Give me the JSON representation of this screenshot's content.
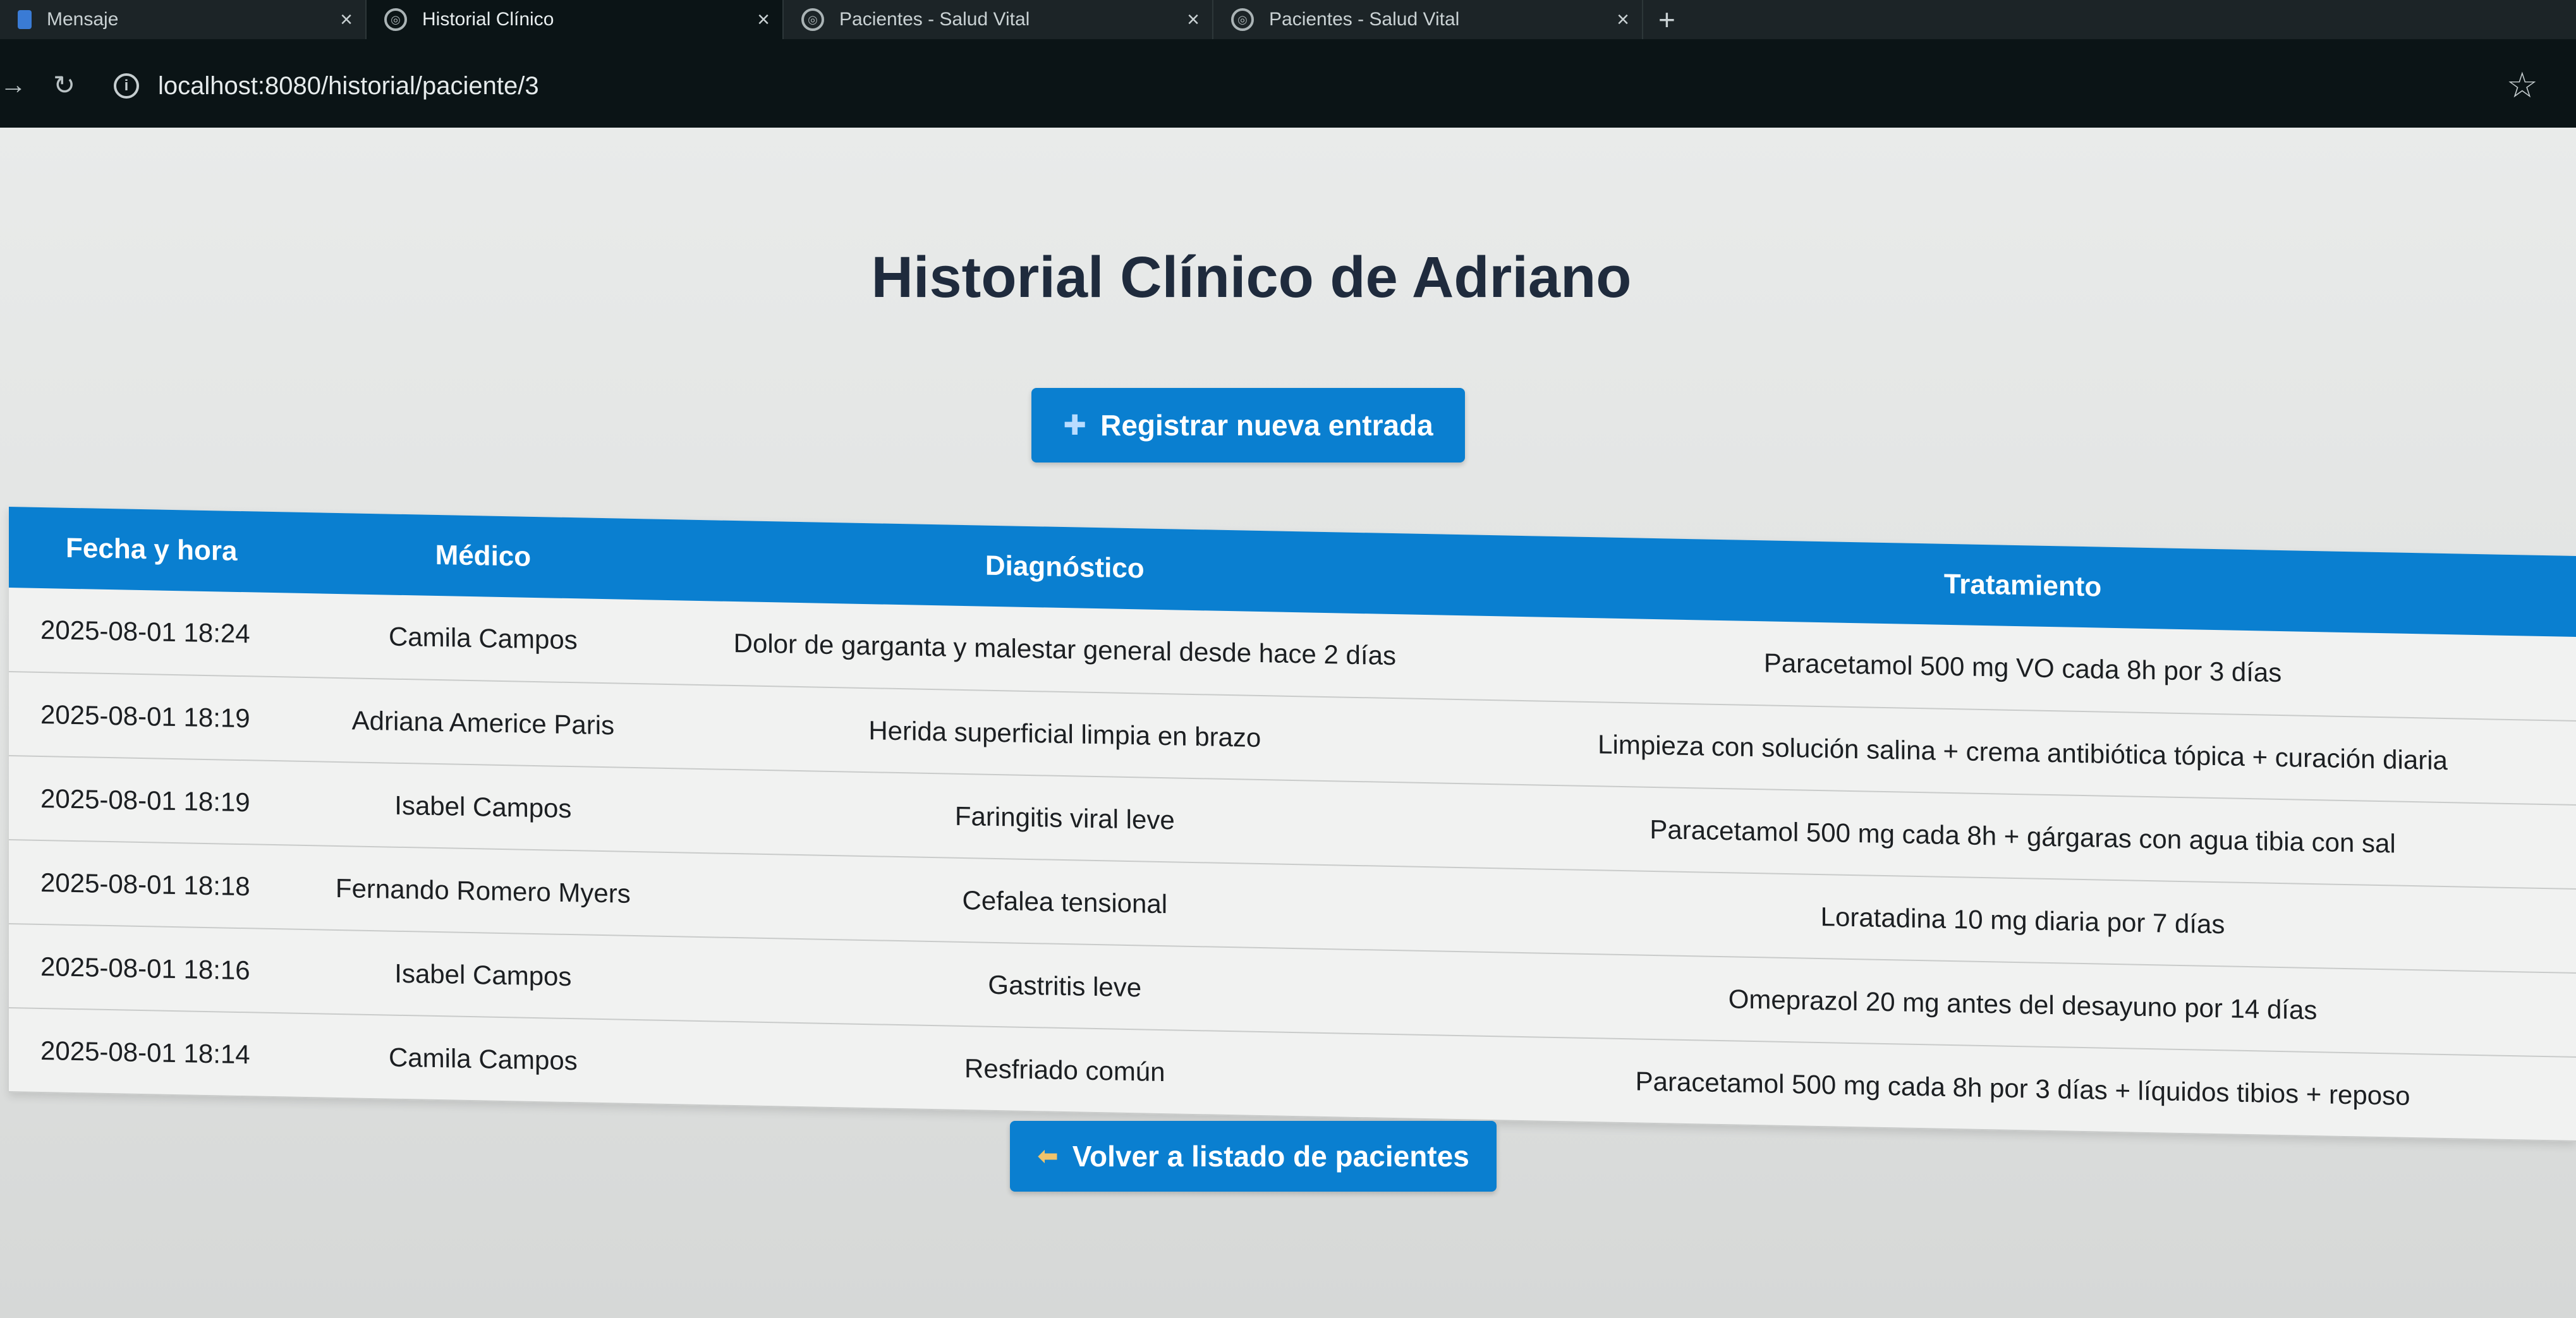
{
  "browser": {
    "tabs": [
      {
        "title": "Mensaje",
        "active": false
      },
      {
        "title": "Historial Clínico",
        "active": true
      },
      {
        "title": "Pacientes - Salud Vital",
        "active": false
      },
      {
        "title": "Pacientes - Salud Vital",
        "active": false
      }
    ],
    "close_glyph": "×",
    "new_tab_glyph": "+",
    "url": "localhost:8080/historial/paciente/3"
  },
  "page": {
    "title": "Historial Clínico de Adriano",
    "new_entry_button": "Registrar nueva entrada",
    "back_button": "Volver a listado de pacientes",
    "accent_color": "#0a7fd0",
    "title_color": "#1f2b3d"
  },
  "table": {
    "headers": [
      "Fecha y hora",
      "Médico",
      "Diagnóstico",
      "Tratamiento"
    ],
    "rows": [
      {
        "fecha": "2025-08-01 18:24",
        "medico": "Camila Campos",
        "diagnostico": "Dolor de garganta y malestar general desde hace 2 días",
        "tratamiento": "Paracetamol 500 mg VO cada 8h por 3 días"
      },
      {
        "fecha": "2025-08-01 18:19",
        "medico": "Adriana Americe Paris",
        "diagnostico": "Herida superficial limpia en brazo",
        "tratamiento": "Limpieza con solución salina + crema antibiótica tópica + curación diaria"
      },
      {
        "fecha": "2025-08-01 18:19",
        "medico": "Isabel Campos",
        "diagnostico": "Faringitis viral leve",
        "tratamiento": "Paracetamol 500 mg cada 8h + gárgaras con agua tibia con sal"
      },
      {
        "fecha": "2025-08-01 18:18",
        "medico": "Fernando Romero Myers",
        "diagnostico": "Cefalea tensional",
        "tratamiento": "Loratadina 10 mg diaria por 7 días"
      },
      {
        "fecha": "2025-08-01 18:16",
        "medico": "Isabel Campos",
        "diagnostico": "Gastritis leve",
        "tratamiento": "Omeprazol 20 mg antes del desayuno por 14 días"
      },
      {
        "fecha": "2025-08-01 18:14",
        "medico": "Camila Campos",
        "diagnostico": "Resfriado común",
        "tratamiento": "Paracetamol 500 mg cada 8h por 3 días + líquidos tibios + reposo"
      }
    ]
  },
  "icons": {
    "tab_globe": "globe-icon",
    "tab_message": "message-app-icon",
    "reload": "reload-icon",
    "info": "info-icon",
    "bookmark": "star-icon",
    "new_entry": "plus-icon",
    "back": "back-arrow-icon"
  }
}
